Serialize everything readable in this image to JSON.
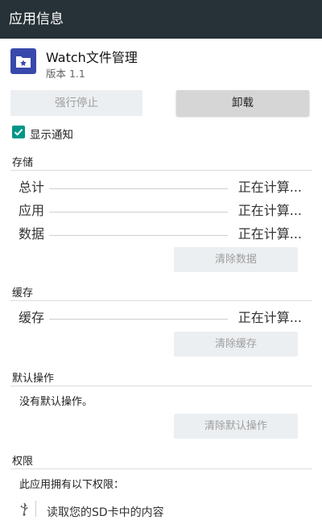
{
  "titlebar": {
    "title": "应用信息"
  },
  "app": {
    "name": "Watch文件管理",
    "version": "版本 1.1",
    "icon": "folder-star-icon",
    "icon_color": "#3949ab"
  },
  "actions": {
    "force_stop": "强行停止",
    "uninstall": "卸载"
  },
  "notify": {
    "label": "显示通知",
    "checked": true,
    "color": "#009688"
  },
  "storage": {
    "heading": "存储",
    "rows": [
      {
        "label": "总计",
        "value": "正在计算..."
      },
      {
        "label": "应用",
        "value": "正在计算..."
      },
      {
        "label": "数据",
        "value": "正在计算..."
      }
    ],
    "clear_button": "清除数据"
  },
  "cache": {
    "heading": "缓存",
    "rows": [
      {
        "label": "缓存",
        "value": "正在计算..."
      }
    ],
    "clear_button": "清除缓存"
  },
  "defaults": {
    "heading": "默认操作",
    "text": "没有默认操作。",
    "clear_button": "清除默认操作"
  },
  "permissions": {
    "heading": "权限",
    "intro": "此应用拥有以下权限：",
    "items": [
      {
        "icon": "usb-icon",
        "text": "读取您的SD卡中的内容"
      }
    ]
  }
}
